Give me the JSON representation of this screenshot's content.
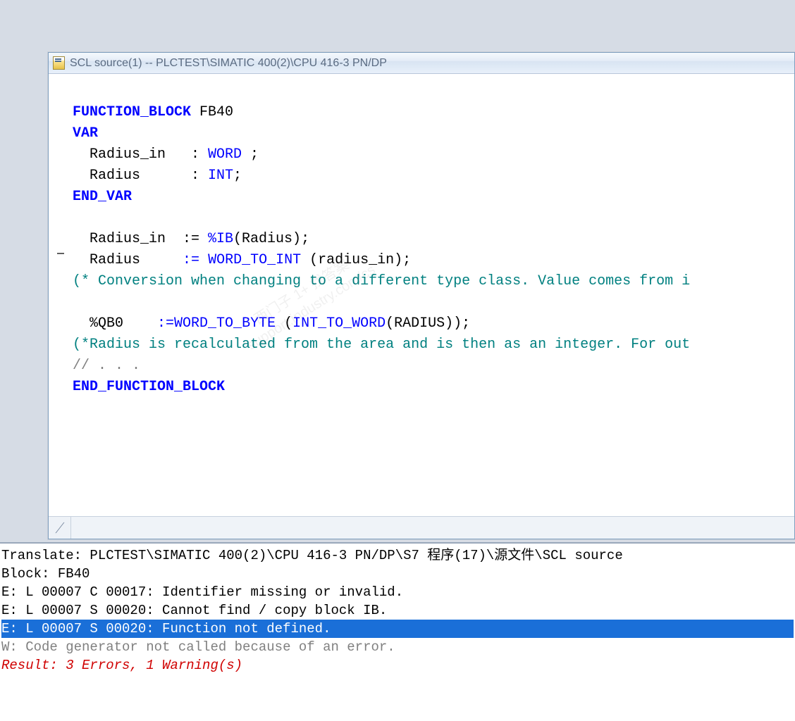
{
  "window": {
    "title": "SCL source(1) -- PLCTEST\\SIMATIC 400(2)\\CPU 416-3 PN/DP"
  },
  "code": {
    "kw_function_block": "FUNCTION_BLOCK",
    "fb_name": " FB40",
    "kw_var": "VAR",
    "decl_radius_in_name": "  Radius_in   : ",
    "decl_radius_in_type": "WORD",
    "decl_radius_in_tail": " ;",
    "decl_radius_name": "  Radius      : ",
    "decl_radius_type": "INT",
    "decl_radius_tail": ";",
    "kw_end_var": "END_VAR",
    "assign1_lhs": "  Radius_in  := ",
    "assign1_pct": "%IB",
    "assign1_rest": "(Radius);",
    "assign2_lhs": "  Radius     ",
    "assign2_asgn": ":=",
    "assign2_sp": " ",
    "assign2_fn": "WORD_TO_INT",
    "assign2_rest": " (radius_in);",
    "comment1": "(* Conversion when changing to a different type class. Value comes from i",
    "assign3_lhs": "  %QB0    ",
    "assign3_asgn": ":=",
    "assign3_fn1": "WORD_TO_BYTE",
    "assign3_mid": " (",
    "assign3_fn2": "INT_TO_WORD",
    "assign3_rest": "(RADIUS));",
    "comment2": "(*Radius is recalculated from the area and is then as an integer. For out",
    "greyc": "// . . .",
    "kw_end_fb": "END_FUNCTION_BLOCK"
  },
  "output": {
    "line1": "Translate: PLCTEST\\SIMATIC 400(2)\\CPU 416-3 PN/DP\\S7 程序(17)\\源文件\\SCL source",
    "line2": "Block: FB40",
    "line3": "E: L 00007 C 00017: Identifier missing or invalid.",
    "line4": "E: L 00007 S 00020: Cannot find / copy block IB.",
    "line5": "E: L 00007 S 00020: Function not defined.",
    "line6": "W: Code generator not called because of an error.",
    "result": "Result: 3 Errors, 1 Warning(s)"
  },
  "watermark": {
    "l1": "西门子 1+ 找答案",
    "l2": "support.industry.com/cs"
  }
}
